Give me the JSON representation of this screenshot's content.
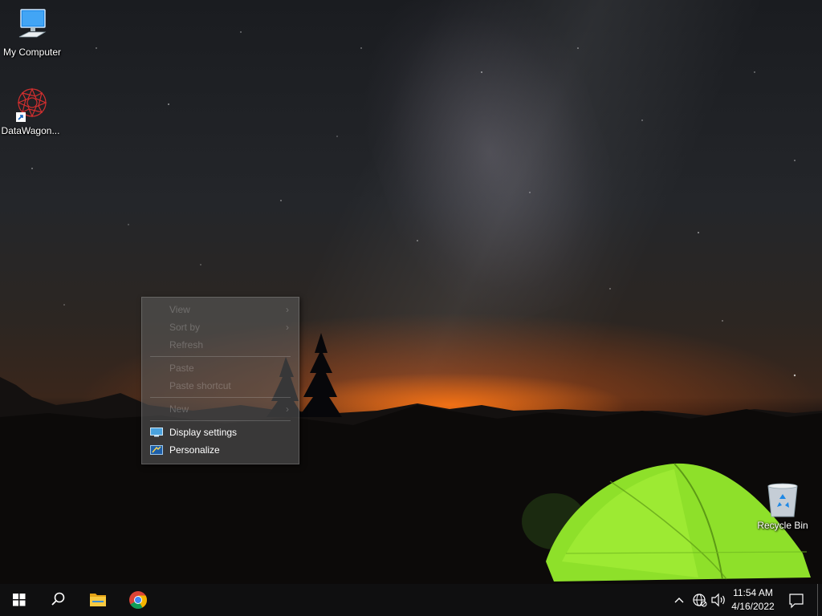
{
  "desktop": {
    "icons": [
      {
        "label": "My Computer",
        "icon": "computer-icon"
      },
      {
        "label": "DataWagon...",
        "icon": "datawagon-icon"
      },
      {
        "label": "Recycle Bin",
        "icon": "recycle-bin-icon"
      }
    ]
  },
  "context_menu": {
    "items": [
      {
        "label": "View",
        "enabled": false,
        "submenu": true
      },
      {
        "label": "Sort by",
        "enabled": false,
        "submenu": true
      },
      {
        "label": "Refresh",
        "enabled": false,
        "submenu": false
      },
      {
        "label": "Paste",
        "enabled": false,
        "submenu": false
      },
      {
        "label": "Paste shortcut",
        "enabled": false,
        "submenu": false
      },
      {
        "label": "New",
        "enabled": false,
        "submenu": true
      },
      {
        "label": "Display settings",
        "enabled": true,
        "icon": "display-settings-icon"
      },
      {
        "label": "Personalize",
        "enabled": true,
        "icon": "personalize-icon"
      }
    ],
    "submenu_arrow": "›"
  },
  "taskbar": {
    "buttons": [
      {
        "name": "start",
        "icon": "windows-start-icon"
      },
      {
        "name": "search",
        "icon": "search-icon"
      },
      {
        "name": "file-explorer",
        "icon": "folder-icon"
      },
      {
        "name": "chrome",
        "icon": "chrome-icon"
      }
    ],
    "tray": {
      "icons": [
        "chevron-up-icon",
        "network-icon",
        "volume-icon"
      ],
      "time": "11:54 AM",
      "date": "4/16/2022",
      "notification_icon": "notification-icon"
    }
  },
  "colors": {
    "taskbar_bg": "#0f0f10",
    "tent_green": "#8ee02a",
    "horizon_orange": "#ff7a18"
  }
}
